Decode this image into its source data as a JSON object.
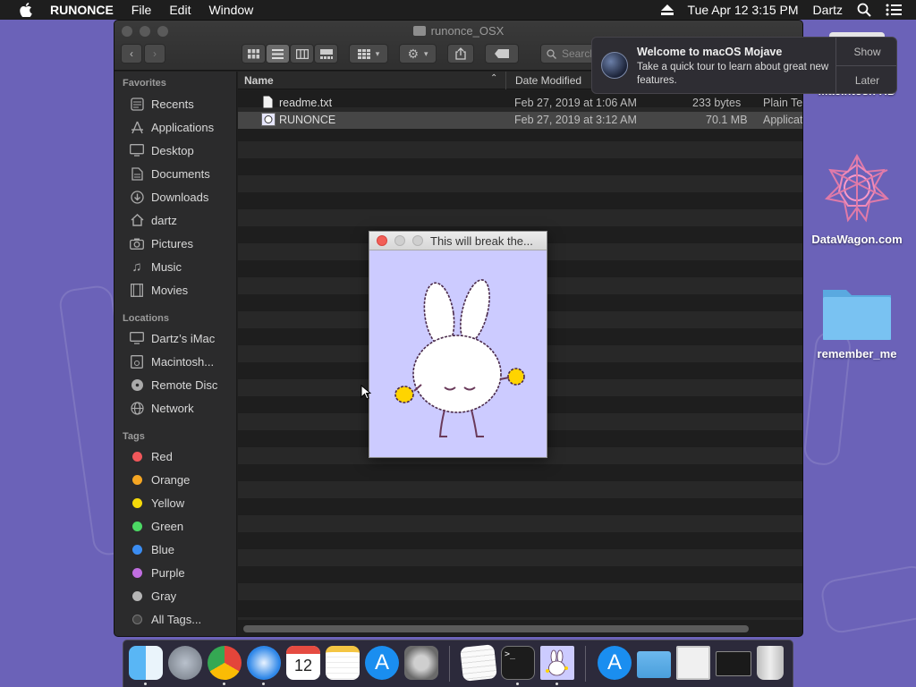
{
  "menubar": {
    "app_name": "RUNONCE",
    "menus": [
      "File",
      "Edit",
      "Window"
    ],
    "clock": "Tue Apr 12  3:15 PM",
    "user": "Dartz"
  },
  "finder": {
    "title": "runonce_OSX",
    "search_placeholder": "Search",
    "favorites_header": "Favorites",
    "favorites": [
      "Recents",
      "Applications",
      "Desktop",
      "Documents",
      "Downloads",
      "dartz",
      "Pictures",
      "Music",
      "Movies"
    ],
    "locations_header": "Locations",
    "locations": [
      "Dartz’s iMac",
      "Macintosh...",
      "Remote Disc",
      "Network"
    ],
    "tags_header": "Tags",
    "tags": [
      {
        "label": "Red",
        "color": "#f0575a"
      },
      {
        "label": "Orange",
        "color": "#f5a623"
      },
      {
        "label": "Yellow",
        "color": "#f5d90a"
      },
      {
        "label": "Green",
        "color": "#4cd964"
      },
      {
        "label": "Blue",
        "color": "#3b8df2"
      },
      {
        "label": "Purple",
        "color": "#c06ee0"
      },
      {
        "label": "Gray",
        "color": "#b5b5b5"
      },
      {
        "label": "All Tags...",
        "color": ""
      }
    ],
    "columns": {
      "name": "Name",
      "date": "Date Modified",
      "size": "",
      "kind": ""
    },
    "files": [
      {
        "name": "readme.txt",
        "date": "Feb 27, 2019 at 1:06 AM",
        "size": "233 bytes",
        "kind": "Plain Te"
      },
      {
        "name": "RUNONCE",
        "date": "Feb 27, 2019 at 3:12 AM",
        "size": "70.1 MB",
        "kind": "Applicat"
      }
    ]
  },
  "app_window": {
    "title": "This will break the..."
  },
  "notification": {
    "title": "Welcome to macOS Mojave",
    "body": "Take a quick tour to learn about great new features.",
    "show_label": "Show",
    "later_label": "Later"
  },
  "desktop_icons": [
    "Macintosh HD",
    "DataWagon.com",
    "remember_me"
  ]
}
